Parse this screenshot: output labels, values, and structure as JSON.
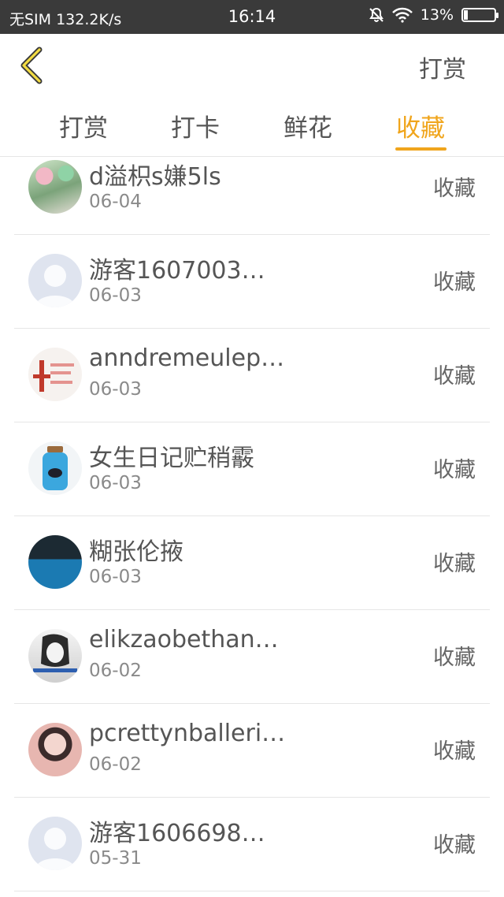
{
  "status_bar": {
    "carrier": "无SIM 132.2K/s",
    "time": "16:14",
    "battery": "13%"
  },
  "header": {
    "back_icon": "chevron-left-icon",
    "action_label": "打赏"
  },
  "tabs": [
    {
      "label": "打赏",
      "active": false
    },
    {
      "label": "打卡",
      "active": false
    },
    {
      "label": "鲜花",
      "active": false
    },
    {
      "label": "收藏",
      "active": true
    }
  ],
  "accent_color": "#f0a51c",
  "list": [
    {
      "name": "d溢枳s嫌5ls",
      "date": "06-04",
      "action": "收藏"
    },
    {
      "name": "游客1607003…",
      "date": "06-03",
      "action": "收藏"
    },
    {
      "name": "anndremeulep…",
      "date": "06-03",
      "action": "收藏"
    },
    {
      "name": "女生日记贮稍霰",
      "date": "06-03",
      "action": "收藏"
    },
    {
      "name": "糊张伦掖",
      "date": "06-03",
      "action": "收藏"
    },
    {
      "name": "elikzaobethan…",
      "date": "06-02",
      "action": "收藏"
    },
    {
      "name": "pcrettynballeri…",
      "date": "06-02",
      "action": "收藏"
    },
    {
      "name": "游客1606698…",
      "date": "05-31",
      "action": "收藏"
    }
  ]
}
